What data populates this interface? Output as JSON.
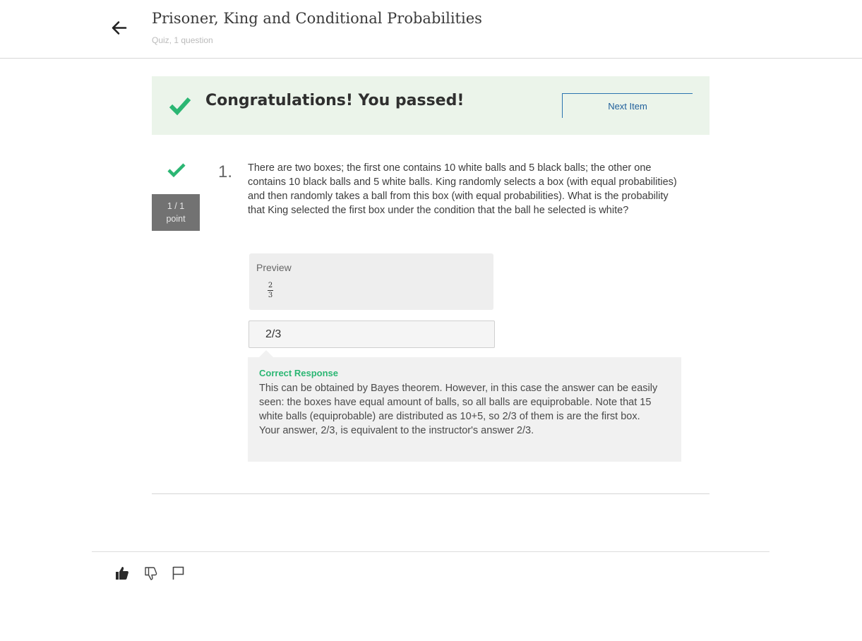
{
  "header": {
    "title": "Prisoner, King and Conditional Probabilities",
    "subtitle": "Quiz, 1 question",
    "back_icon": "arrow-left-icon"
  },
  "banner": {
    "message": "Congratulations! You passed!",
    "next_label": "Next Item",
    "accent_color": "#2bb673",
    "background": "#ebf4ea"
  },
  "question": {
    "number": "1.",
    "points_line1": "1 / 1",
    "points_line2": "point",
    "text": "There are two boxes; the first one contains 10 white balls and 5 black balls; the other one contains 10 black balls and 5 white balls. King randomly selects a box (with equal probabilities) and then randomly takes a ball from this box (with equal probabilities). What is the probability that King selected the first box under the condition that the ball he selected is white?",
    "status_icon": "checkmark-icon"
  },
  "preview": {
    "label": "Preview",
    "numerator": "2",
    "denominator": "3"
  },
  "answer": {
    "value": "2/3"
  },
  "feedback": {
    "title": "Correct Response",
    "explanation": "This can be obtained by Bayes theorem. However, in this case the answer can be easily seen: the boxes have equal amount of balls, so all balls are equiprobable. Note that 15 white balls (equiprobable) are distributed as 10+5, so 2/3 of them is are the first box.",
    "verdict": "Your answer, 2/3, is equivalent to the instructor's answer 2/3."
  },
  "footer": {
    "icons": [
      "thumbs-up-icon",
      "thumbs-down-icon",
      "flag-icon"
    ]
  }
}
